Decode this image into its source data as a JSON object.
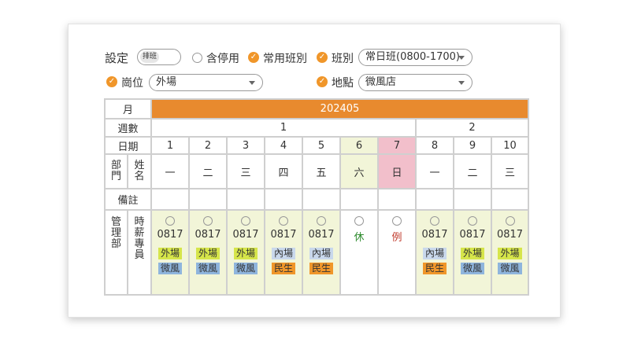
{
  "settings": {
    "title": "設定",
    "shift_toggle_label": "排班",
    "include_disabled_label": "含停用",
    "common_shift_label": "常用班別",
    "shift_label": "班別",
    "shift_value": "常日班(0800-1700)",
    "post_label": "崗位",
    "post_value": "外場",
    "location_label": "地點",
    "location_value": "微風店"
  },
  "table": {
    "month_label": "月",
    "month_value": "202405",
    "week_label": "週數",
    "weeks": [
      "1",
      "2"
    ],
    "date_label": "日期",
    "dates": [
      "1",
      "2",
      "3",
      "4",
      "5",
      "6",
      "7",
      "8",
      "9",
      "10"
    ],
    "dept_label": "部門",
    "name_label": "姓名",
    "weekdays": [
      "一",
      "二",
      "三",
      "四",
      "五",
      "六",
      "日",
      "一",
      "二",
      "三"
    ],
    "note_label": "備註",
    "row": {
      "dept": "管理部",
      "name": "時薪專員",
      "cells": [
        {
          "code": "0817",
          "tag1": "外場",
          "tag2": "微風"
        },
        {
          "code": "0817",
          "tag1": "外場",
          "tag2": "微風"
        },
        {
          "code": "0817",
          "tag1": "外場",
          "tag2": "微風"
        },
        {
          "code": "0817",
          "tag1": "內場",
          "tag2": "民生"
        },
        {
          "code": "0817",
          "tag1": "內場",
          "tag2": "民生"
        },
        {
          "code": "休"
        },
        {
          "code": "例"
        },
        {
          "code": "0817",
          "tag1": "內場",
          "tag2": "民生"
        },
        {
          "code": "0817",
          "tag1": "外場",
          "tag2": "微風"
        },
        {
          "code": "0817",
          "tag1": "外場",
          "tag2": "微風"
        }
      ]
    }
  },
  "colors": {
    "accent": "#e88a2e",
    "rest_text": "#2e8b2e",
    "regular_off_text": "#c0392b"
  }
}
